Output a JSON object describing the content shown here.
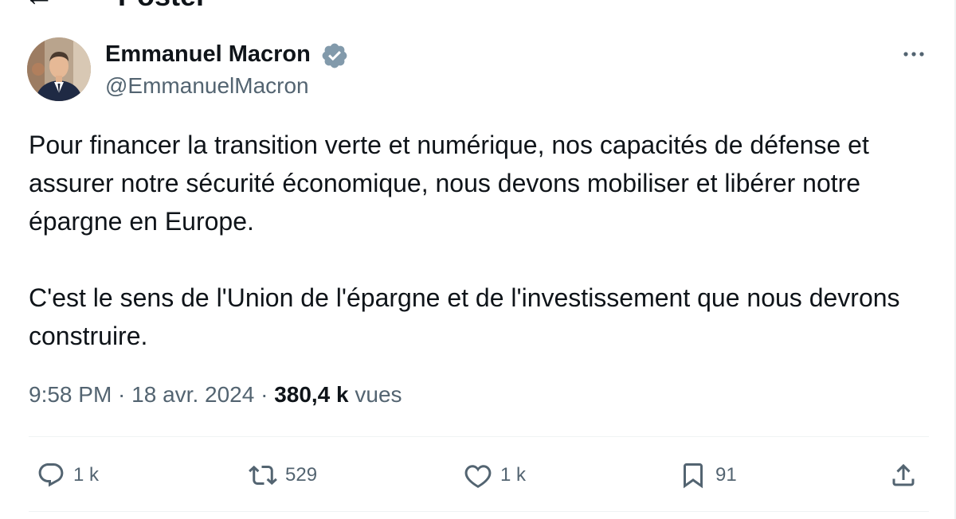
{
  "header": {
    "title": "Poster",
    "back_icon": "arrow-left-icon"
  },
  "author": {
    "name": "Emmanuel Macron",
    "handle": "@EmmanuelMacron",
    "verified_icon": "verified-badge-icon",
    "verified_color": "#829aab"
  },
  "tweet": {
    "paragraphs": [
      "Pour financer la transition verte et numérique, nos capacités de défense et assurer notre sécurité économique, nous devons mobiliser et libérer notre épargne en Europe.",
      "C'est le sens de l'Union de l'épargne et de l'investissement que nous devrons construire."
    ]
  },
  "meta": {
    "time": "9:58 PM",
    "separator": " · ",
    "date": "18 avr. 2024",
    "views_count": "380,4 k",
    "views_label": "vues"
  },
  "actions": {
    "reply": {
      "icon": "reply-icon",
      "count": "1 k"
    },
    "repost": {
      "icon": "repost-icon",
      "count": "529"
    },
    "like": {
      "icon": "heart-icon",
      "count": "1 k"
    },
    "bookmark": {
      "icon": "bookmark-icon",
      "count": "91"
    },
    "share": {
      "icon": "share-icon"
    }
  },
  "colors": {
    "text_primary": "#0f1419",
    "text_secondary": "#536471",
    "divider": "#eff3f4"
  }
}
